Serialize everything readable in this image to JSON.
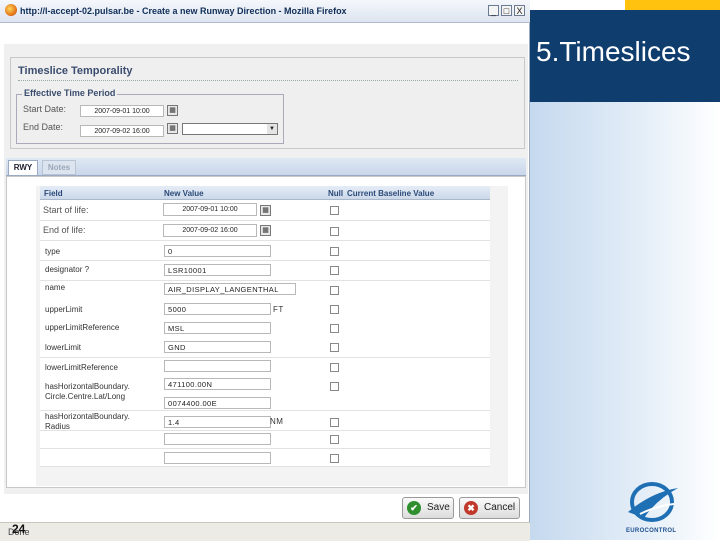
{
  "slide": {
    "title": "5.Timeslices",
    "page_number": "24",
    "logo_text": "EUROCONTROL",
    "colors": {
      "title_bg": "#0f3d6e",
      "accent": "#ffc20e"
    }
  },
  "window": {
    "title": "http://l-accept-02.pulsar.be - Create a new Runway Direction - Mozilla Firefox",
    "controls": [
      "_",
      "□",
      "X"
    ],
    "status": "Done"
  },
  "temporality": {
    "section_title": "Timeslice Temporality",
    "period_legend": "Effective Time Period",
    "start_label": "Start Date:",
    "start_value": "2007-09-01 10:00",
    "end_label": "End Date:",
    "end_value": "2007-09-02 16:00",
    "end_select_value": ""
  },
  "tabs": [
    {
      "label": "RWY",
      "active": true
    },
    {
      "label": "Notes",
      "active": false
    }
  ],
  "grid": {
    "headers": {
      "field": "Field",
      "new_value": "New Value",
      "null": "Null",
      "baseline": "Current Baseline Value"
    },
    "rows": [
      {
        "label": "Start of life:",
        "value": "2007-09-01 10:00"
      },
      {
        "label": "End of life:",
        "value": "2007-09-02 16:00"
      },
      {
        "label": "type",
        "value": "0"
      },
      {
        "label": "designator ?",
        "value": "LSR10001"
      },
      {
        "label": "name",
        "value": "AIR_DISPLAY_LANGENTHAL"
      },
      {
        "label": "upperLimit",
        "value": "5000",
        "unit": "FT"
      },
      {
        "label": "upperLimitReference",
        "value": "MSL"
      },
      {
        "label": "lowerLimit",
        "value": "GND"
      },
      {
        "label": "lowerLimitReference",
        "value": ""
      },
      {
        "label": "hasHorizontalBoundary.",
        "label2": "Circle.Centre.Lat/Long",
        "value": "471100.00N",
        "value2": "0074400.00E"
      },
      {
        "label": "hasHorizontalBoundary.",
        "label2": "Radius",
        "value": "1.4",
        "unit": "NM"
      },
      {
        "label": "",
        "value": ""
      },
      {
        "label": "",
        "value": ""
      }
    ]
  },
  "buttons": {
    "save": "Save",
    "cancel": "Cancel"
  }
}
